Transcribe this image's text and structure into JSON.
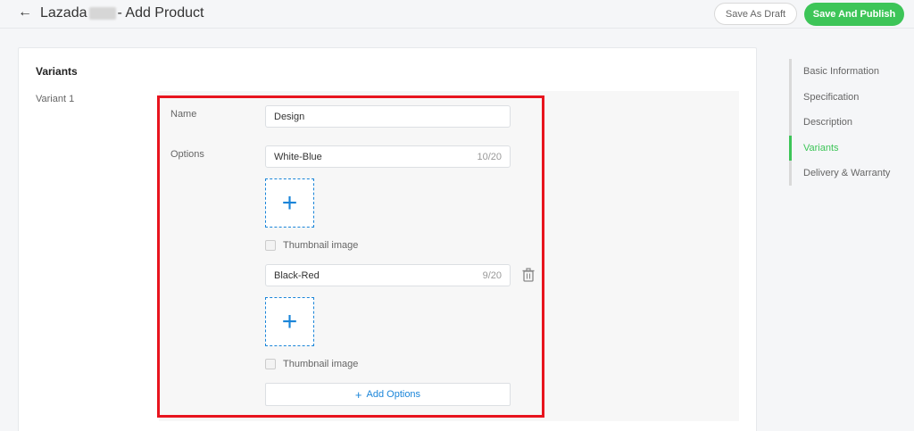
{
  "header": {
    "title_prefix": "Lazada",
    "title_suffix": "- Add Product",
    "save_draft_label": "Save As Draft",
    "save_publish_label": "Save And Publish"
  },
  "variants": {
    "section_title": "Variants",
    "variant_label": "Variant 1",
    "name_label": "Name",
    "name_value": "Design",
    "options_label": "Options",
    "options": [
      {
        "value": "White-Blue",
        "count": "10/20",
        "thumbnail_label": "Thumbnail image"
      },
      {
        "value": "Black-Red",
        "count": "9/20",
        "thumbnail_label": "Thumbnail image"
      }
    ],
    "add_options_label": "Add Options"
  },
  "nav": {
    "items": [
      "Basic Information",
      "Specification",
      "Description",
      "Variants",
      "Delivery & Warranty"
    ],
    "active": "Variants"
  },
  "colors": {
    "accent_green": "#3dc558",
    "link_blue": "#1a85d9",
    "highlight_red": "#e8141e"
  }
}
